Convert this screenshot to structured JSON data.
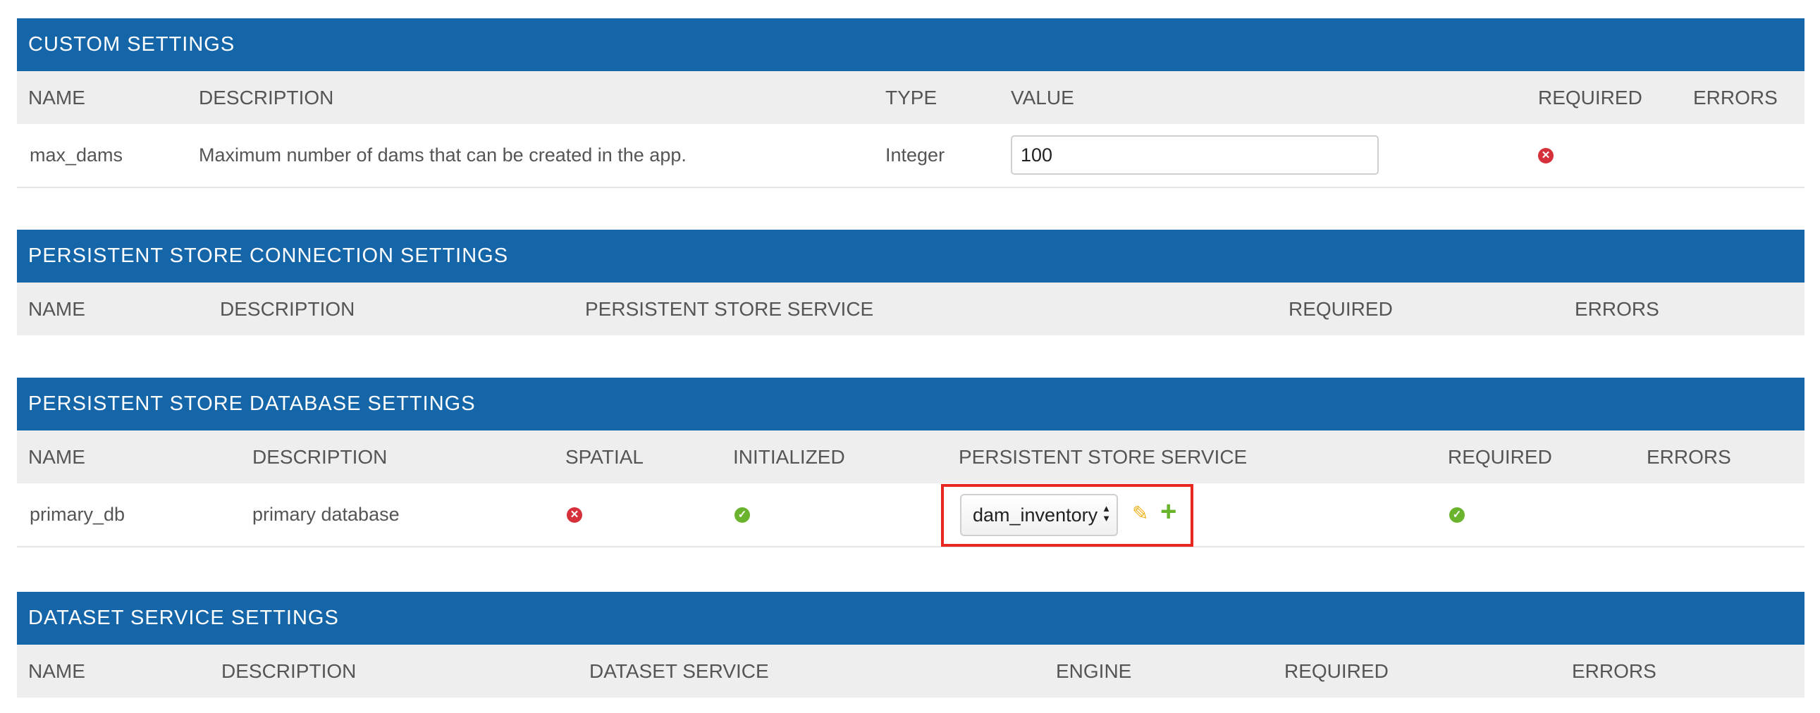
{
  "custom_settings": {
    "title": "CUSTOM SETTINGS",
    "columns": [
      "NAME",
      "DESCRIPTION",
      "TYPE",
      "VALUE",
      "REQUIRED",
      "ERRORS"
    ],
    "row": {
      "name": "max_dams",
      "description": "Maximum number of dams that can be created in the app.",
      "type": "Integer",
      "value": "100",
      "required": "no",
      "errors": ""
    }
  },
  "persistent_store_connection_settings": {
    "title": "PERSISTENT STORE CONNECTION SETTINGS",
    "columns": [
      "NAME",
      "DESCRIPTION",
      "PERSISTENT STORE SERVICE",
      "REQUIRED",
      "ERRORS"
    ]
  },
  "persistent_store_database_settings": {
    "title": "PERSISTENT STORE DATABASE SETTINGS",
    "columns": [
      "NAME",
      "DESCRIPTION",
      "SPATIAL",
      "INITIALIZED",
      "PERSISTENT STORE SERVICE",
      "REQUIRED",
      "ERRORS"
    ],
    "row": {
      "name": "primary_db",
      "description": "primary database",
      "spatial": "no",
      "initialized": "yes",
      "service_selected": "dam_inventory",
      "required": "yes",
      "errors": ""
    }
  },
  "dataset_service_settings": {
    "title": "DATASET SERVICE SETTINGS",
    "columns": [
      "NAME",
      "DESCRIPTION",
      "DATASET SERVICE",
      "ENGINE",
      "REQUIRED",
      "ERRORS"
    ]
  },
  "icons": {
    "no": "x-circle-icon",
    "yes": "check-circle-icon",
    "edit": "pencil-icon",
    "add": "plus-icon"
  },
  "colors": {
    "header_blue": "#1565a9",
    "error_red": "#d6303a",
    "success_green": "#6ab42d",
    "edit_yellow": "#f0b21a",
    "highlight_red": "#e8281e"
  }
}
